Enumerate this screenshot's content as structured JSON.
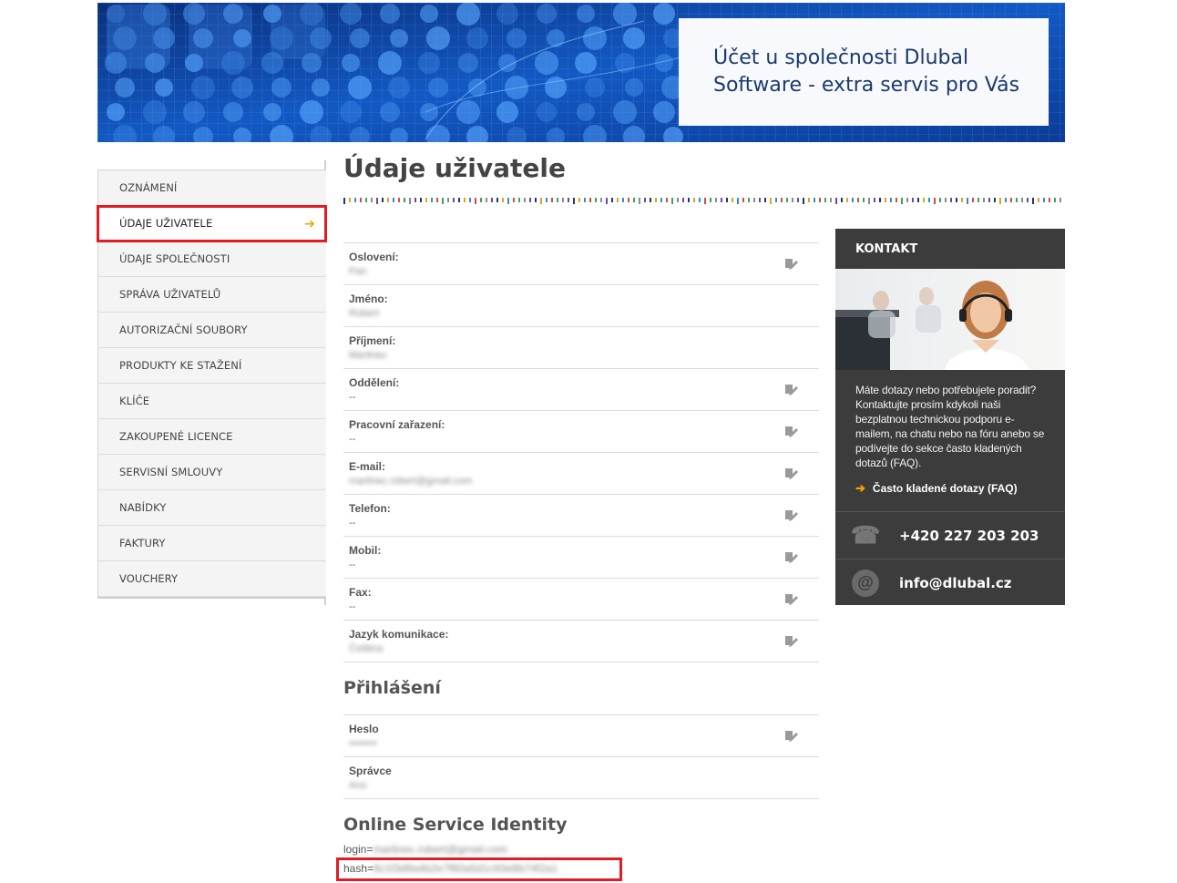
{
  "banner": {
    "line1": "Účet u společnosti Dlubal",
    "line2": "Software - extra servis pro Vás"
  },
  "sidebar": {
    "items": [
      {
        "label": "Oznámení",
        "active": false
      },
      {
        "label": "Údaje uživatele",
        "active": true
      },
      {
        "label": "Údaje společnosti",
        "active": false
      },
      {
        "label": "Správa uživatelů",
        "active": false
      },
      {
        "label": "Autorizační soubory",
        "active": false
      },
      {
        "label": "Produkty ke stažení",
        "active": false
      },
      {
        "label": "Klíče",
        "active": false
      },
      {
        "label": "Zakoupené licence",
        "active": false
      },
      {
        "label": "Servisní smlouvy",
        "active": false
      },
      {
        "label": "Nabídky",
        "active": false
      },
      {
        "label": "Faktury",
        "active": false
      },
      {
        "label": "Vouchery",
        "active": false
      }
    ],
    "active_arrow": "➔"
  },
  "main": {
    "title": "Údaje uživatele",
    "fields": [
      {
        "label": "Oslovení:",
        "value": "Pan",
        "blurred": true,
        "editable": true
      },
      {
        "label": "Jméno:",
        "value": "Robert",
        "blurred": true,
        "editable": false
      },
      {
        "label": "Příjmení:",
        "value": "Martinec",
        "blurred": true,
        "editable": false
      },
      {
        "label": "Oddělení:",
        "value": "--",
        "blurred": false,
        "editable": true
      },
      {
        "label": "Pracovní zařazení:",
        "value": "--",
        "blurred": false,
        "editable": true
      },
      {
        "label": "E-mail:",
        "value": "martinec.robert@gmail.com",
        "blurred": true,
        "editable": true
      },
      {
        "label": "Telefon:",
        "value": "--",
        "blurred": false,
        "editable": true
      },
      {
        "label": "Mobil:",
        "value": "--",
        "blurred": false,
        "editable": true
      },
      {
        "label": "Fax:",
        "value": "--",
        "blurred": false,
        "editable": true
      },
      {
        "label": "Jazyk komunikace:",
        "value": "Čeština",
        "blurred": true,
        "editable": true
      }
    ],
    "login_section": {
      "title": "Přihlášení",
      "fields": [
        {
          "label": "Heslo",
          "value": "••••••••",
          "blurred": true,
          "editable": true
        },
        {
          "label": "Správce",
          "value": "Ano",
          "blurred": true,
          "editable": false
        }
      ]
    },
    "osi": {
      "title": "Online Service Identity",
      "login_prefix": "login=",
      "login_value": "martinec.robert@gmail.com",
      "hash_prefix": "hash=",
      "hash_value": "8c1f3d9a4b2e7f60a5d1c93e8b74f2a1"
    }
  },
  "contact": {
    "header": "KONTAKT",
    "text": "Máte dotazy nebo potřebujete poradit? Kontaktujte prosím kdykoli naši bezplatnou technickou podporu e-mailem, na chatu nebo na fóru anebo se podívejte do sekce často kladených dotazů (FAQ).",
    "faq_label": "Často kladené dotazy (FAQ)",
    "phone": "+420 227 203 203",
    "email": "info@dlubal.cz"
  },
  "colors": {
    "accent_arrow": "#f0a500",
    "highlight_box": "#e31b23",
    "contact_bg": "#3c3c3c",
    "banner_text": "#1b3a6e"
  }
}
